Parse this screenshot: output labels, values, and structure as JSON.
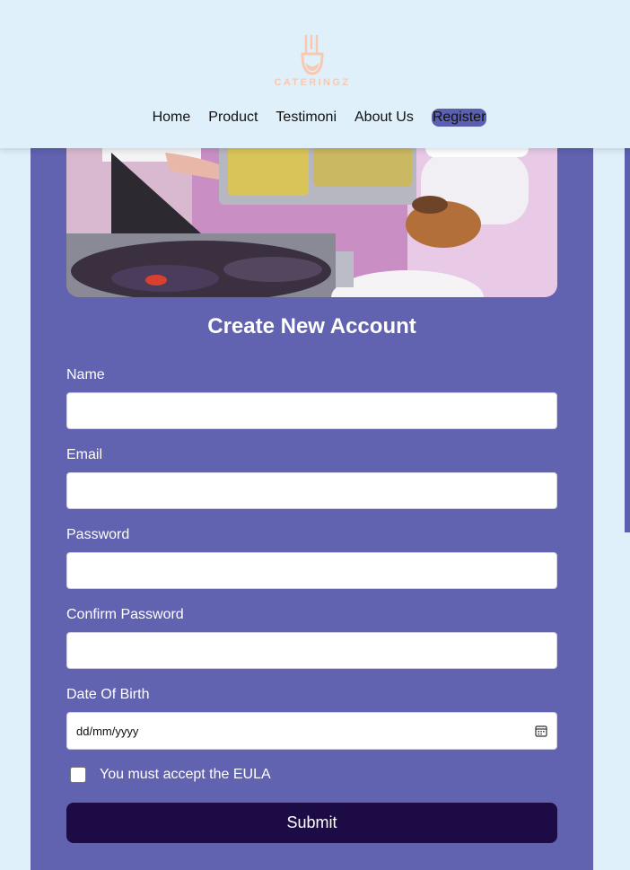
{
  "header": {
    "logo_text": "CATERINGZ",
    "nav": {
      "home": "Home",
      "product": "Product",
      "testimoni": "Testimoni",
      "about": "About Us",
      "register": "Register"
    }
  },
  "form": {
    "title": "Create New Account",
    "name_label": "Name",
    "email_label": "Email",
    "password_label": "Password",
    "confirm_label": "Confirm Password",
    "dob_label": "Date Of Birth",
    "dob_placeholder": "dd/mm/yyyy",
    "eula_text": "You must accept the EULA",
    "submit_label": "Submit"
  },
  "colors": {
    "page_bg": "#e0f0fa",
    "card_bg": "#6162b0",
    "active_nav_bg": "#5b5fb0",
    "submit_bg": "#1c0b45",
    "logo_color": "#f7c9b0"
  }
}
